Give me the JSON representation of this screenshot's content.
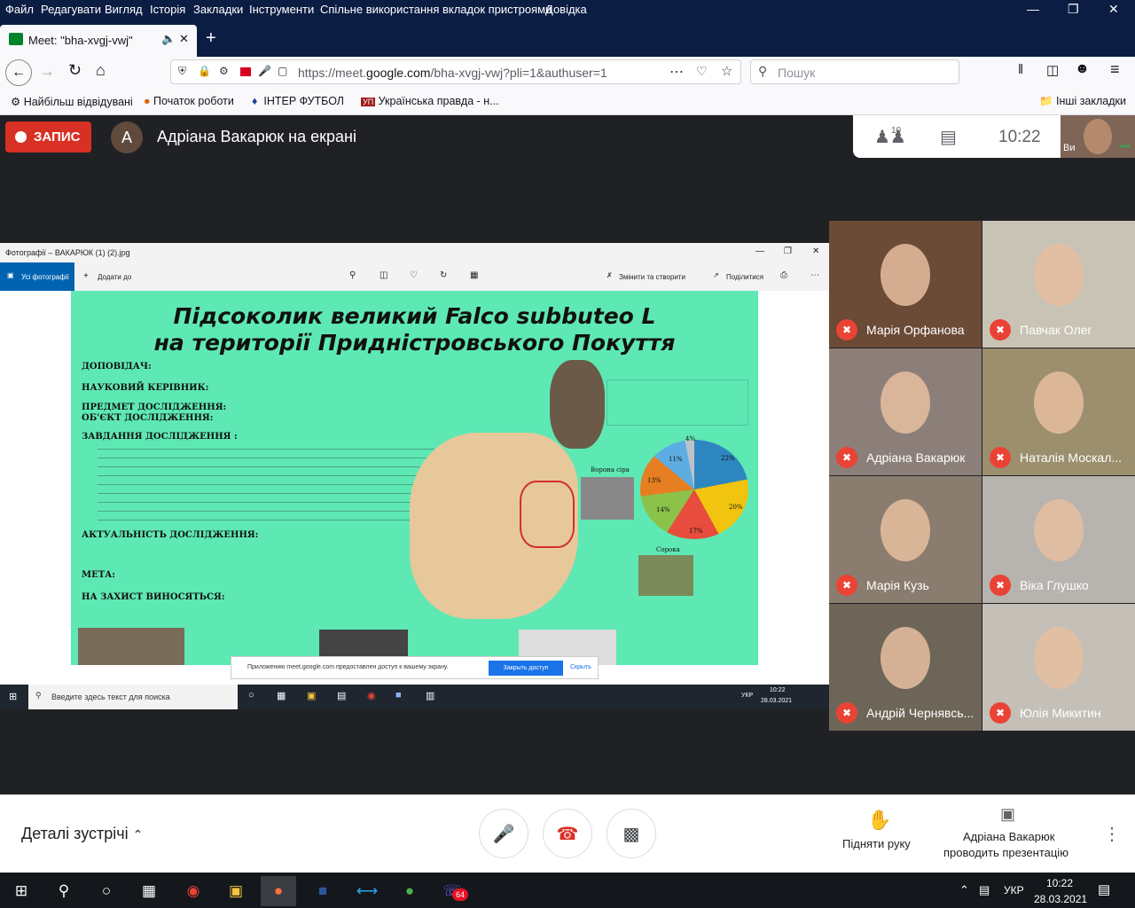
{
  "browser": {
    "menu": [
      "Файл",
      "Редагувати",
      "Вигляд",
      "Історія",
      "Закладки",
      "Інструменти",
      "Спільне використання вкладок пристроями",
      "Довідка"
    ],
    "tab_title": "Meet: \"bha-xvgj-vwj\"",
    "url_prefix": "https://meet.",
    "url_domain": "google.com",
    "url_rest": "/bha-xvgj-vwj?pli=1&authuser=1",
    "search_placeholder": "Пошук",
    "bookmarks": [
      "Найбільш відвідувані",
      "Початок роботи",
      "ІНТЕР ФУТБОЛ",
      "Українська правда - н..."
    ],
    "other_bookmarks": "Інші закладки"
  },
  "meet": {
    "record_label": "ЗАПИС",
    "presenter_initial": "А",
    "presenter_title": "Адріана Вакарюк на екрані",
    "participants_count": "10",
    "time": "10:22",
    "self_label": "Ви",
    "participants": [
      {
        "name": "Марія Орфанова",
        "muted": true,
        "bg": "#6b4a36"
      },
      {
        "name": "Павчак Олег",
        "muted": true,
        "bg": "#c9c3b6"
      },
      {
        "name": "Адріана Вакарюк",
        "muted": true,
        "bg": "#8c7f79"
      },
      {
        "name": "Наталія Москал...",
        "muted": true,
        "bg": "#9b8f6e"
      },
      {
        "name": "Марія Кузь",
        "muted": true,
        "bg": "#8a7d6f"
      },
      {
        "name": "Віка Глушко",
        "muted": true,
        "bg": "#b7b3ae"
      },
      {
        "name": "Андрій Чернявсь...",
        "muted": true,
        "bg": "#6d6558"
      },
      {
        "name": "Юлія Микитин",
        "muted": true,
        "bg": "#c4bfb7"
      }
    ],
    "meeting_details": "Деталі зустрічі",
    "raise_hand": "Підняти руку",
    "presenting_line1": "Адріана Вакарюк",
    "presenting_line2": "проводить презентацію"
  },
  "shared_window": {
    "title": "Фотографії – ВАКАРЮК (1) (2).jpg",
    "all_photos": "Усі фотографії",
    "add_to": "Додати до",
    "edit_create": "Змінити та створити",
    "share": "Поділитися",
    "poster_title_line1": "Підсоколик великий Falco subbuteo L",
    "poster_title_line2": "на території Придністровського Покуття",
    "poster_sections": [
      "ДОПОВІДАЧ:",
      "НАУКОВИЙ КЕРІВНИК:",
      "ПРЕДМЕТ ДОСЛІДЖЕННЯ:",
      "ОБ'ЄКТ ДОСЛІДЖЕННЯ:",
      "ЗАВДАННЯ ДОСЛІДЖЕННЯ :",
      "АКТУАЛЬНІСТЬ ДОСЛІДЖЕННЯ:",
      "МЕТА:",
      "НА ЗАХИСТ ВИНОСЯТЬСЯ:"
    ],
    "poster_bird_labels": [
      "Ворона сіра",
      "Сорока"
    ],
    "pie_labels": [
      "22%",
      "20%",
      "17%",
      "14%",
      "13%",
      "11%",
      "4%"
    ],
    "notice_text": "Приложению meet.google.com предоставлен доступ к вашему экрану.",
    "notice_button": "Закрыть доступ",
    "notice_hide": "Скрыть",
    "task_search": "Введите здесь текст для поиска",
    "task_lang": "УКР",
    "task_time": "10:22",
    "task_date": "28.03.2021"
  },
  "taskbar": {
    "lang": "УКР",
    "time": "10:22",
    "date": "28.03.2021",
    "viber_badge": "64"
  }
}
